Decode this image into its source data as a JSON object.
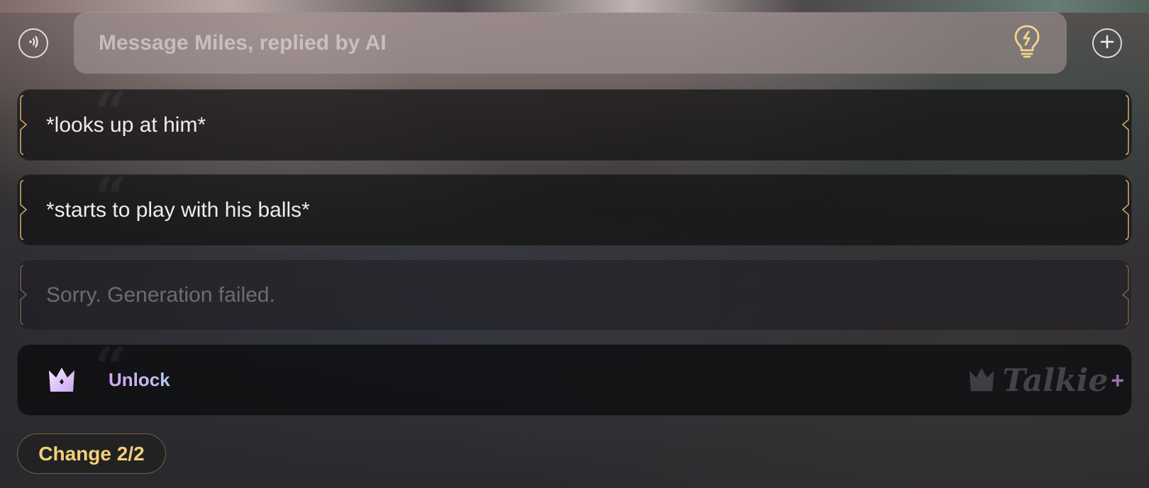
{
  "input": {
    "placeholder": "Message Miles, replied by AI",
    "value": ""
  },
  "icons": {
    "voice": "voice-wave-icon",
    "hint": "lightbulb-bolt-icon",
    "add": "plus-circle-icon",
    "premium": "crown-icon"
  },
  "options": [
    {
      "text": "*looks up at him*"
    },
    {
      "text": "*starts to play with his balls*"
    },
    {
      "text": "Sorry. Generation failed."
    }
  ],
  "unlock": {
    "label": "Unlock",
    "brand": "Talkie",
    "brand_suffix": "+"
  },
  "change": {
    "label": "Change 2/2"
  },
  "colors": {
    "accent_gold": "#f3cf7a",
    "bulb_yellow": "#f5d58a",
    "unlock_gradient": [
      "#d7a6f2",
      "#b9c8ef"
    ]
  }
}
